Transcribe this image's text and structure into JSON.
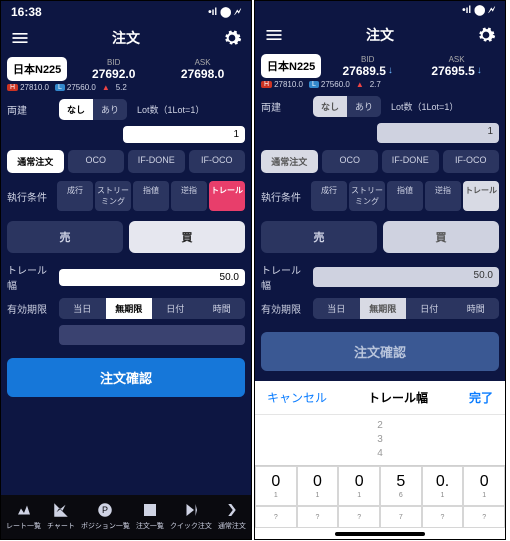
{
  "left": {
    "time": "16:38",
    "title": "注文",
    "symbol": "日本N225",
    "bid_label": "BID",
    "bid_price": "27692.0",
    "ask_label": "ASK",
    "ask_price": "27698.0",
    "high": "27810.0",
    "low": "27560.0",
    "change": "5.2",
    "ryodate_label": "両建",
    "ryodate_nashi": "なし",
    "ryodate_ari": "あり",
    "lot_label": "Lot数（1Lot=1）",
    "lot_value": "1",
    "ordtype_normal": "通常注文",
    "ordtype_oco": "OCO",
    "ordtype_ifdone": "IF-DONE",
    "ordtype_ifoco": "IF-OCO",
    "exec_label": "執行条件",
    "exec_nariyuki": "成行",
    "exec_streaming": "ストリーミング",
    "exec_sashine": "指値",
    "exec_gyakusashi": "逆指",
    "exec_trail": "トレール",
    "sell": "売",
    "buy": "買",
    "trail_label": "トレール幅",
    "trail_value": "50.0",
    "expiry_label": "有効期限",
    "expiry_today": "当日",
    "expiry_unlimited": "無期限",
    "expiry_dated": "日付",
    "expiry_time": "時間",
    "confirm": "注文確認",
    "tabs": [
      "レート一覧",
      "チャート",
      "ポジション一覧",
      "注文一覧",
      "クイック注文",
      "通常注文"
    ]
  },
  "right": {
    "title": "注文",
    "symbol": "日本N225",
    "bid_label": "BID",
    "bid_price": "27689.5",
    "ask_label": "ASK",
    "ask_price": "27695.5",
    "high": "27810.0",
    "low": "27560.0",
    "change": "2.7",
    "confirm": "注文確認",
    "picker_cancel": "キャンセル",
    "picker_title": "トレール幅",
    "picker_done": "完了",
    "wheel_prev": [
      "2",
      "3",
      "4"
    ],
    "keypad_row1": [
      "0",
      "0",
      "0",
      "5",
      "0.",
      "0"
    ],
    "keypad_sub": [
      "1",
      "1",
      "1",
      "6",
      "1",
      "1"
    ],
    "keypad_row2": [
      "?",
      "?",
      "?",
      "7",
      "?",
      "?"
    ]
  }
}
